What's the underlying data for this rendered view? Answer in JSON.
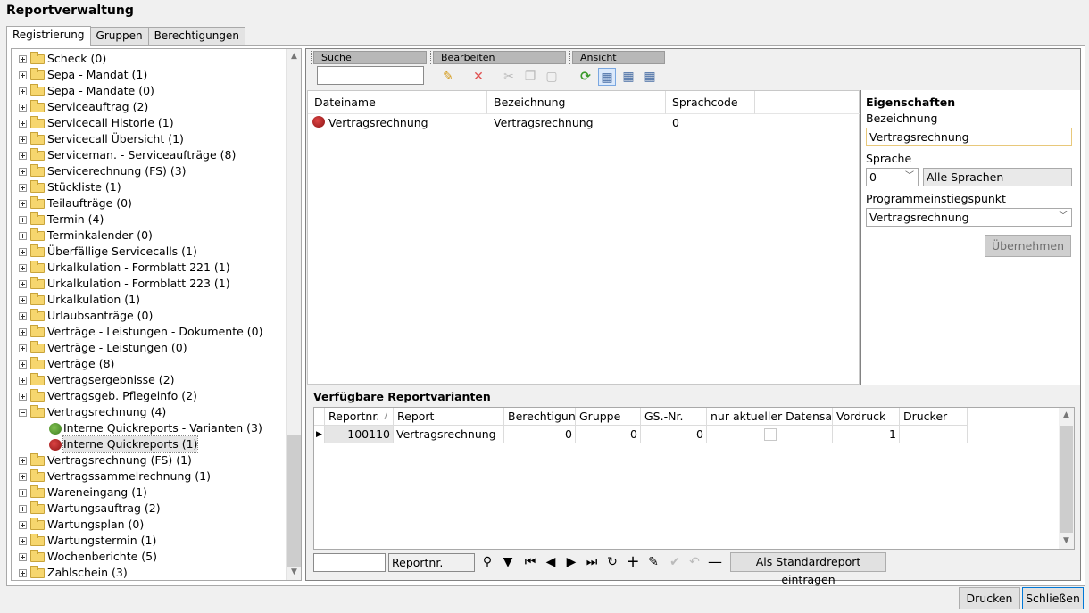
{
  "window": {
    "title": "Reportverwaltung"
  },
  "tabs": [
    {
      "label": "Registrierung",
      "active": true
    },
    {
      "label": "Gruppen",
      "active": false
    },
    {
      "label": "Berechtigungen",
      "active": false
    }
  ],
  "tree": {
    "items": [
      {
        "label": "Scheck (0)",
        "type": "folder",
        "expanded": false
      },
      {
        "label": "Sepa - Mandat (1)",
        "type": "folder",
        "expanded": false
      },
      {
        "label": "Sepa - Mandate (0)",
        "type": "folder",
        "expanded": false
      },
      {
        "label": "Serviceauftrag (2)",
        "type": "folder",
        "expanded": false
      },
      {
        "label": "Servicecall Historie (1)",
        "type": "folder",
        "expanded": false
      },
      {
        "label": "Servicecall Übersicht (1)",
        "type": "folder",
        "expanded": false
      },
      {
        "label": "Serviceman. - Serviceaufträge (8)",
        "type": "folder",
        "expanded": false
      },
      {
        "label": "Servicerechnung (FS) (3)",
        "type": "folder",
        "expanded": false
      },
      {
        "label": "Stückliste (1)",
        "type": "folder",
        "expanded": false
      },
      {
        "label": "Teilaufträge (0)",
        "type": "folder",
        "expanded": false
      },
      {
        "label": "Termin (4)",
        "type": "folder",
        "expanded": false
      },
      {
        "label": "Terminkalender (0)",
        "type": "folder",
        "expanded": false
      },
      {
        "label": "Überfällige Servicecalls (1)",
        "type": "folder",
        "expanded": false
      },
      {
        "label": "Urkalkulation - Formblatt 221 (1)",
        "type": "folder",
        "expanded": false
      },
      {
        "label": "Urkalkulation - Formblatt 223 (1)",
        "type": "folder",
        "expanded": false
      },
      {
        "label": "Urkalkulation (1)",
        "type": "folder",
        "expanded": false
      },
      {
        "label": "Urlaubsanträge (0)",
        "type": "folder",
        "expanded": false
      },
      {
        "label": "Verträge - Leistungen - Dokumente (0)",
        "type": "folder",
        "expanded": false
      },
      {
        "label": "Verträge - Leistungen (0)",
        "type": "folder",
        "expanded": false
      },
      {
        "label": "Verträge (8)",
        "type": "folder",
        "expanded": false
      },
      {
        "label": "Vertragsergebnisse (2)",
        "type": "folder",
        "expanded": false
      },
      {
        "label": "Vertragsgeb. Pflegeinfo (2)",
        "type": "folder",
        "expanded": false
      },
      {
        "label": "Vertragsrechnung (4)",
        "type": "folder",
        "expanded": true
      },
      {
        "label": "Interne Quickreports - Varianten (3)",
        "type": "report-green",
        "child": true
      },
      {
        "label": "Interne Quickreports (1)",
        "type": "report-red",
        "child": true,
        "selected": true
      },
      {
        "label": "Vertragsrechnung (FS) (1)",
        "type": "folder",
        "expanded": false
      },
      {
        "label": "Vertragssammelrechnung (1)",
        "type": "folder",
        "expanded": false
      },
      {
        "label": "Wareneingang (1)",
        "type": "folder",
        "expanded": false
      },
      {
        "label": "Wartungsauftrag (2)",
        "type": "folder",
        "expanded": false
      },
      {
        "label": "Wartungsplan (0)",
        "type": "folder",
        "expanded": false
      },
      {
        "label": "Wartungstermin (1)",
        "type": "folder",
        "expanded": false
      },
      {
        "label": "Wochenberichte (5)",
        "type": "folder",
        "expanded": false
      },
      {
        "label": "Zahlschein (3)",
        "type": "folder",
        "expanded": false
      }
    ]
  },
  "toolbar": {
    "search_group": "Suche",
    "edit_group": "Bearbeiten",
    "view_group": "Ansicht",
    "search_value": ""
  },
  "file_grid": {
    "columns": [
      "Dateiname",
      "Bezeichnung",
      "Sprachcode"
    ],
    "rows": [
      {
        "dateiname": "Vertragsrechnung",
        "bezeichnung": "Vertragsrechnung",
        "sprachcode": "0"
      }
    ]
  },
  "properties": {
    "title": "Eigenschaften",
    "bezeichnung_label": "Bezeichnung",
    "bezeichnung_value": "Vertragsrechnung",
    "sprache_label": "Sprache",
    "sprache_value": "0",
    "sprache_name": "Alle Sprachen",
    "entry_label": "Programmeinstiegspunkt",
    "entry_value": "Vertragsrechnung",
    "apply_label": "Übernehmen"
  },
  "variants": {
    "title": "Verfügbare Reportvarianten",
    "columns": [
      "Reportnr.",
      "Report",
      "Berechtigung",
      "Gruppe",
      "GS.-Nr.",
      "nur aktueller Datensatz",
      "Vordruck",
      "Drucker"
    ],
    "sort_indicator": "/",
    "rows": [
      {
        "reportnr": "100110",
        "report": "Vertragsrechnung",
        "berechtigung": "0",
        "gruppe": "0",
        "gsnr": "0",
        "nur_aktuell": false,
        "vordruck": "1",
        "drucker": ""
      }
    ]
  },
  "navigator": {
    "filter_value": "",
    "field_value": "Reportnr.",
    "std_button": "Als Standardreport eintragen"
  },
  "footer": {
    "print_label": "Drucken",
    "close_label": "Schließen"
  }
}
